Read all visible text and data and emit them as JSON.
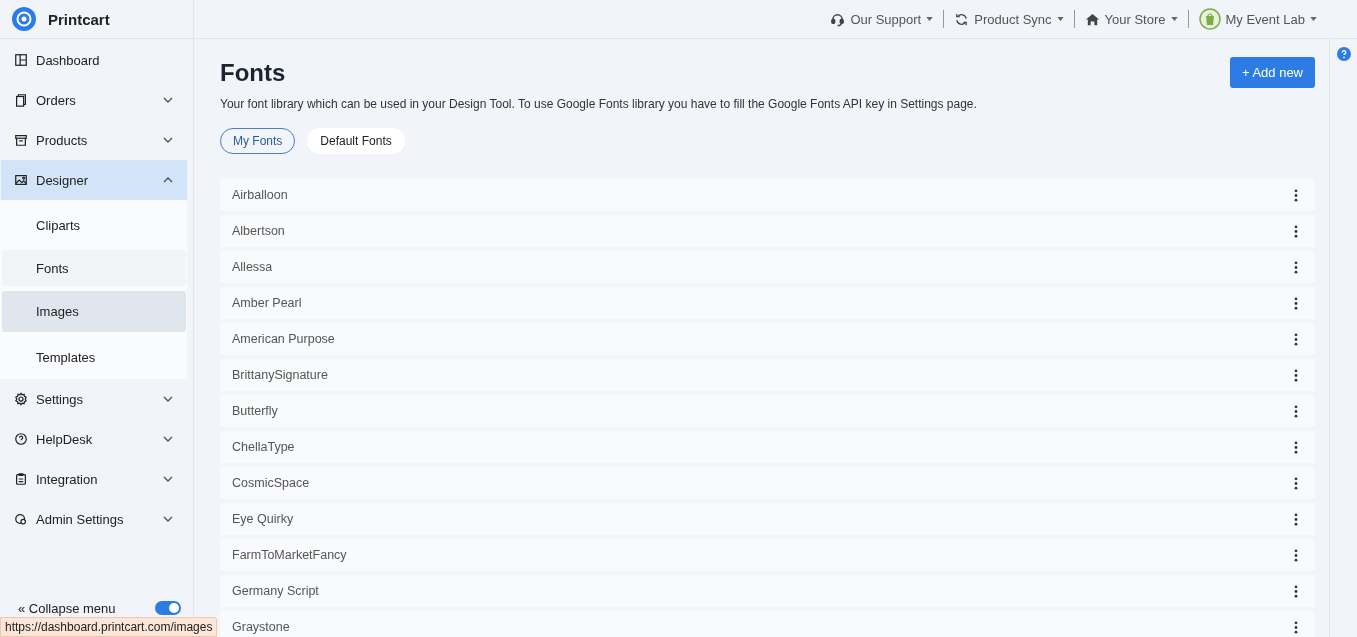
{
  "brand": {
    "name": "Printcart"
  },
  "topbar": {
    "items": [
      {
        "kind": "support",
        "label": "Our Support"
      },
      {
        "kind": "sync",
        "label": "Product Sync"
      },
      {
        "kind": "store",
        "label": "Your Store"
      },
      {
        "kind": "shop",
        "label": "My Event Lab"
      }
    ]
  },
  "sidebar": {
    "items": [
      {
        "kind": "dashboard",
        "label": "Dashboard",
        "selected": false
      },
      {
        "kind": "orders",
        "label": "Orders",
        "expanded": false,
        "selected": false
      },
      {
        "kind": "products",
        "label": "Products",
        "expanded": false,
        "selected": false
      },
      {
        "kind": "designer",
        "label": "Designer",
        "expanded": true,
        "selected": true,
        "children": [
          {
            "label": "Cliparts",
            "selected": false,
            "hovered": false
          },
          {
            "label": "Fonts",
            "selected": true,
            "hovered": false
          },
          {
            "label": "Images",
            "selected": false,
            "hovered": true
          },
          {
            "label": "Templates",
            "selected": false,
            "hovered": false
          }
        ]
      },
      {
        "kind": "settings",
        "label": "Settings",
        "expanded": false,
        "selected": false
      },
      {
        "kind": "helpdesk",
        "label": "HelpDesk",
        "expanded": false,
        "selected": false
      },
      {
        "kind": "integration",
        "label": "Integration",
        "expanded": false,
        "selected": false
      },
      {
        "kind": "admin",
        "label": "Admin Settings",
        "expanded": false,
        "selected": false
      }
    ],
    "collapse": {
      "label": "« Collapse menu",
      "on": true
    }
  },
  "page": {
    "title": "Fonts",
    "description": "Your font library which can be used in your Design Tool. To use Google Fonts library you have to fill the Google Fonts API key in Settings page.",
    "add_button": "+ Add new"
  },
  "tabs": [
    {
      "label": "My Fonts",
      "selected": true
    },
    {
      "label": "Default Fonts",
      "selected": false
    }
  ],
  "fonts": [
    {
      "name": "Airballoon"
    },
    {
      "name": "Albertson"
    },
    {
      "name": "Allessa"
    },
    {
      "name": "Amber Pearl"
    },
    {
      "name": "American Purpose"
    },
    {
      "name": "BrittanySignature"
    },
    {
      "name": "Butterfly"
    },
    {
      "name": "ChellaType"
    },
    {
      "name": "CosmicSpace"
    },
    {
      "name": "Eye Quirky"
    },
    {
      "name": "FarmToMarketFancy"
    },
    {
      "name": "Germany Script"
    },
    {
      "name": "Graystone"
    }
  ],
  "status_url": "https://dashboard.printcart.com/images"
}
